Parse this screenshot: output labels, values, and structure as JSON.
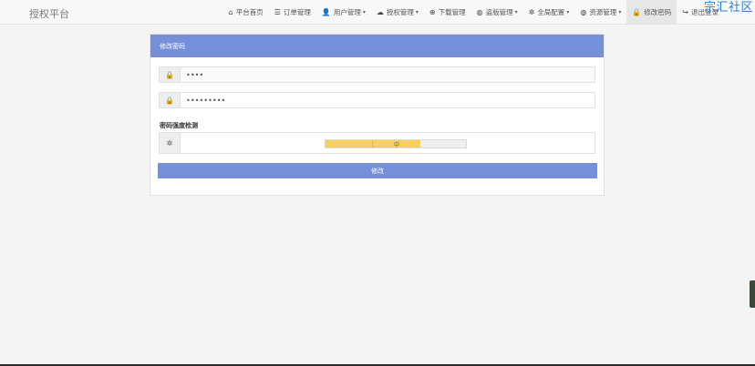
{
  "brand": "授权平台",
  "watermark": "宗汇社区",
  "nav": [
    {
      "icon": "⌂",
      "label": "平台首页",
      "dropdown": false
    },
    {
      "icon": "☰",
      "label": "订单管理",
      "dropdown": false
    },
    {
      "icon": "👤",
      "label": "用户管理",
      "dropdown": true
    },
    {
      "icon": "☁",
      "label": "授权管理",
      "dropdown": true
    },
    {
      "icon": "⊕",
      "label": "下载管理",
      "dropdown": false
    },
    {
      "icon": "◍",
      "label": "盗版管理",
      "dropdown": true
    },
    {
      "icon": "✲",
      "label": "全局配置",
      "dropdown": true
    },
    {
      "icon": "◍",
      "label": "资源管理",
      "dropdown": true
    },
    {
      "icon": "🔒",
      "label": "修改密码",
      "dropdown": false,
      "active": true
    },
    {
      "icon": "↪",
      "label": "退出登录",
      "dropdown": false
    }
  ],
  "panel": {
    "title": "修改密码",
    "old_password": "••••",
    "new_password": "•••••••••",
    "strength_label": "密码强度检测",
    "strength_text": "中",
    "strength_level": "2 of 3",
    "submit_label": "修改"
  },
  "colors": {
    "primary": "#7590d8",
    "meter": "#f7cf5c",
    "watermark": "#2f7fd0"
  }
}
